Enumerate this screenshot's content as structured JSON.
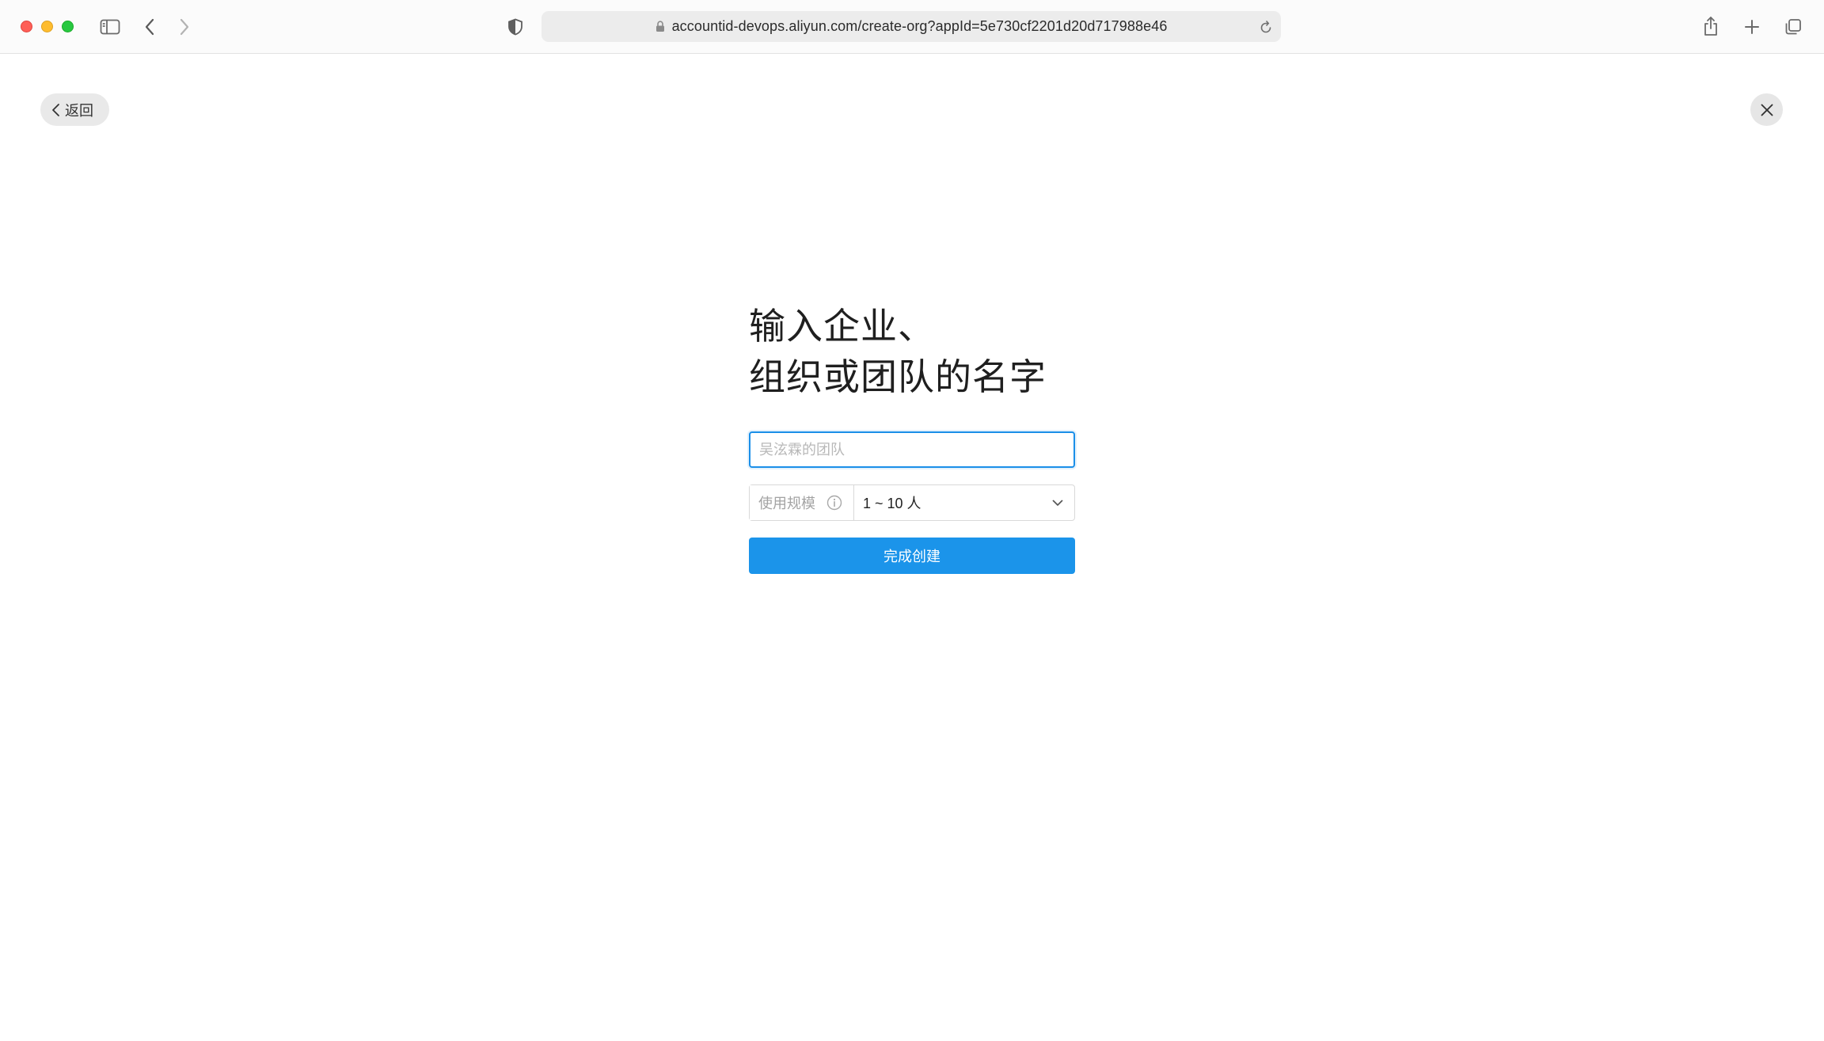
{
  "browser": {
    "url": "accountid-devops.aliyun.com/create-org?appId=5e730cf2201d20d717988e46",
    "icons": {
      "close": "close-window-dot",
      "minimize": "minimize-window-dot",
      "zoom": "zoom-window-dot",
      "sidebar": "sidebar-toggle-icon",
      "back": "chevron-left-icon",
      "forward": "chevron-right-icon",
      "privacy": "shield-icon",
      "lock": "lock-icon",
      "reload": "reload-icon",
      "share": "share-icon",
      "new_tab": "plus-icon",
      "tabs": "tabs-overview-icon"
    }
  },
  "page": {
    "back_label": "返回",
    "title_line1": "输入企业、",
    "title_line2": "组织或团队的名字",
    "name_placeholder": "吴泫霖的团队",
    "scale_label": "使用规模",
    "scale_value": "1 ~ 10 人",
    "submit_label": "完成创建"
  },
  "colors": {
    "primary": "#1b94ea",
    "input_focus_border": "#1b8fe8",
    "title_text": "#1f1f1f"
  }
}
